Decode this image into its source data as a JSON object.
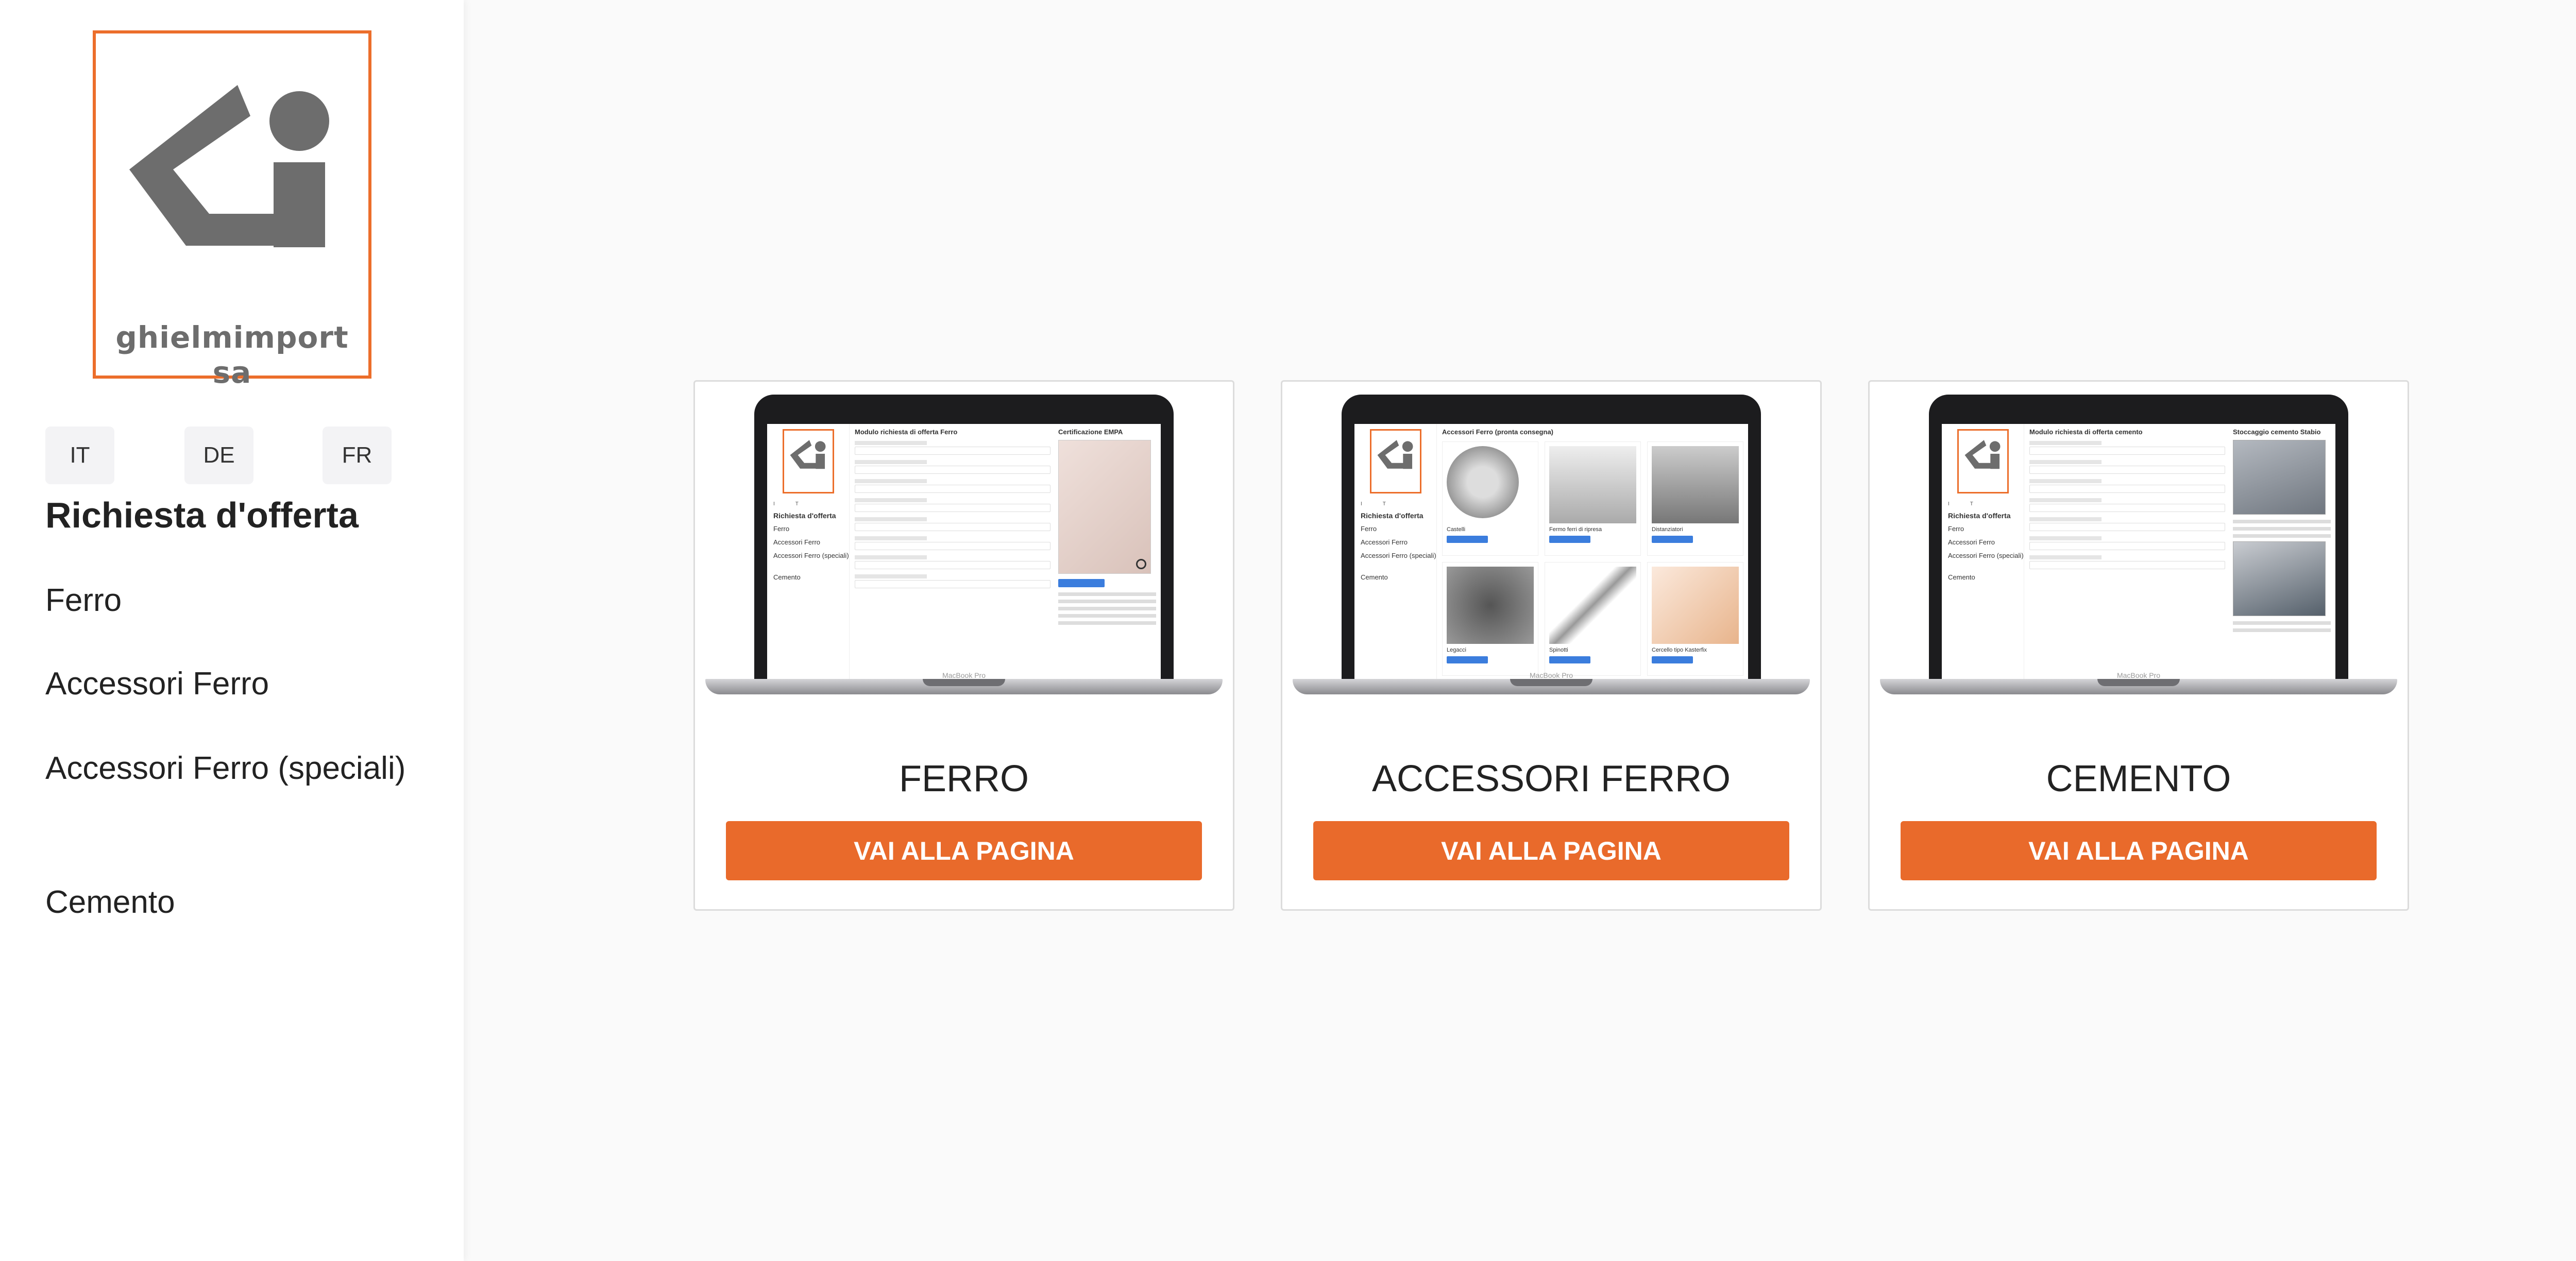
{
  "brand": {
    "name": "ghielmimport sa",
    "accent": "#ec6e2b",
    "button_color": "#e96a2b"
  },
  "languages": [
    "IT",
    "DE",
    "FR"
  ],
  "sidebar": {
    "section_title": "Richiesta d'offerta",
    "items": [
      {
        "label": "Ferro"
      },
      {
        "label": "Accessori Ferro"
      },
      {
        "label": "Accessori Ferro (speciali)"
      },
      {
        "label": "Cemento"
      }
    ]
  },
  "cards": [
    {
      "title": "FERRO",
      "button": "VAI ALLA PAGINA",
      "screen": {
        "heading": "Modulo richiesta di offerta Ferro",
        "right_heading": "Certificazione EMPA"
      }
    },
    {
      "title": "ACCESSORI FERRO",
      "button": "VAI ALLA PAGINA",
      "screen": {
        "heading": "Accessori Ferro (pronta consegna)",
        "products": [
          "Castelli",
          "Fermo ferri di ripresa",
          "Distanziatori",
          "Legacci",
          "Spinotti",
          "Cercello tipo Kasterfix"
        ]
      }
    },
    {
      "title": "CEMENTO",
      "button": "VAI ALLA PAGINA",
      "screen": {
        "heading": "Modulo richiesta di offerta cemento",
        "right_heading": "Stoccaggio cemento Stabio"
      }
    }
  ],
  "laptop_label": "MacBook Pro"
}
